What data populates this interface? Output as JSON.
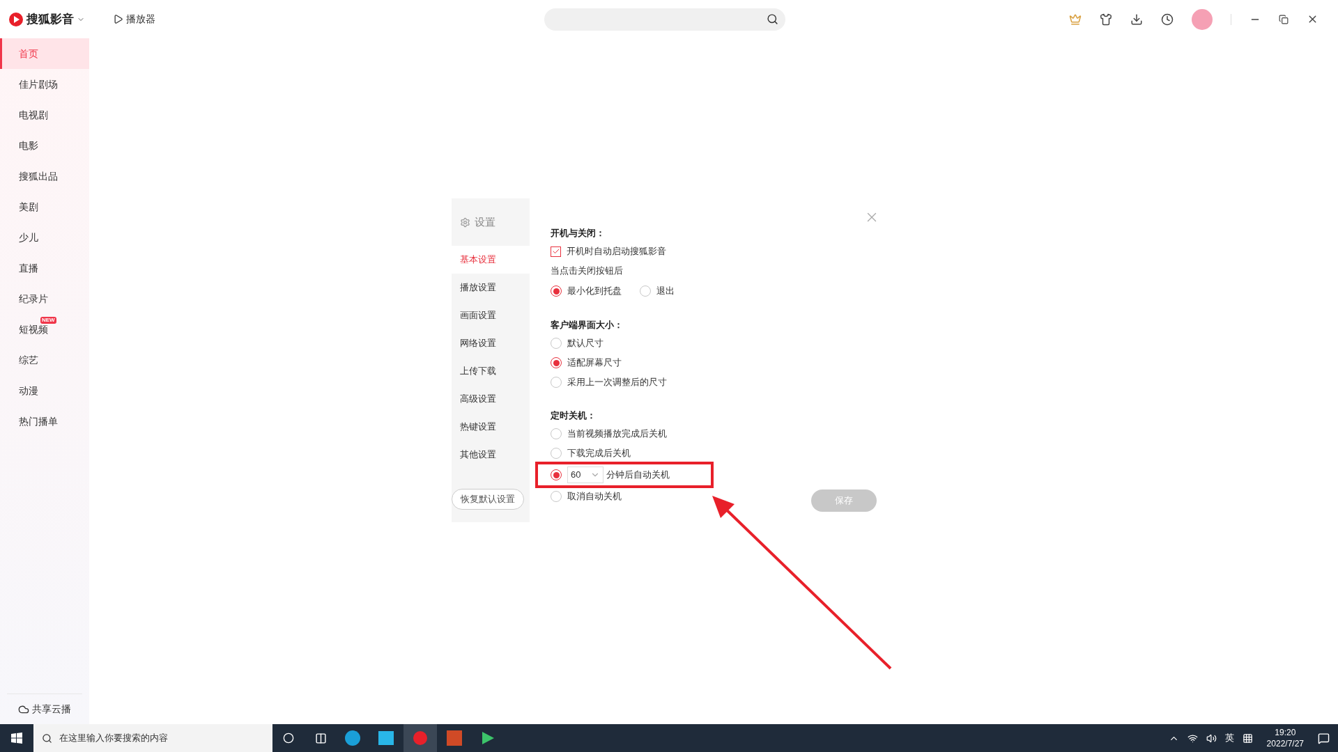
{
  "app": {
    "title": "搜狐影音",
    "player_button": "播放器"
  },
  "sidebar": {
    "items": [
      {
        "label": "首页",
        "selected": true
      },
      {
        "label": "佳片剧场",
        "selected": false
      },
      {
        "label": "电视剧",
        "selected": false
      },
      {
        "label": "电影",
        "selected": false
      },
      {
        "label": "搜狐出品",
        "selected": false
      },
      {
        "label": "美剧",
        "selected": false
      },
      {
        "label": "少儿",
        "selected": false
      },
      {
        "label": "直播",
        "selected": false
      },
      {
        "label": "纪录片",
        "selected": false
      },
      {
        "label": "短视频",
        "selected": false,
        "badge": "NEW"
      },
      {
        "label": "综艺",
        "selected": false
      },
      {
        "label": "动漫",
        "selected": false
      },
      {
        "label": "热门播单",
        "selected": false
      }
    ],
    "footer": "共享云播"
  },
  "settings": {
    "title": "设置",
    "nav": [
      {
        "label": "基本设置",
        "selected": true
      },
      {
        "label": "播放设置",
        "selected": false
      },
      {
        "label": "画面设置",
        "selected": false
      },
      {
        "label": "网络设置",
        "selected": false
      },
      {
        "label": "上传下载",
        "selected": false
      },
      {
        "label": "高级设置",
        "selected": false
      },
      {
        "label": "热键设置",
        "selected": false
      },
      {
        "label": "其他设置",
        "selected": false
      }
    ],
    "restore_button": "恢复默认设置",
    "save_button": {
      "label": "保存",
      "disabled": true
    },
    "sections": [
      {
        "heading": "开机与关闭：",
        "rows": [
          {
            "kind": "checkbox",
            "label": "开机时自动启动搜狐影音",
            "checked": true
          },
          {
            "kind": "note",
            "label": "当点击关闭按钮后"
          },
          {
            "kind": "inline",
            "options": [
              {
                "label": "最小化到托盘",
                "selected": true
              },
              {
                "label": "退出",
                "selected": false
              }
            ]
          }
        ]
      },
      {
        "heading": "客户端界面大小：",
        "rows": [
          {
            "kind": "radio",
            "label": "默认尺寸",
            "selected": false
          },
          {
            "kind": "radio",
            "label": "适配屏幕尺寸",
            "selected": true
          },
          {
            "kind": "radio",
            "label": "采用上一次调整后的尺寸",
            "selected": false
          }
        ]
      },
      {
        "heading": "定时关机：",
        "rows": [
          {
            "kind": "radio",
            "label": "当前视频播放完成后关机",
            "selected": false
          },
          {
            "kind": "radio",
            "label": "下载完成后关机",
            "selected": false
          },
          {
            "kind": "select",
            "value": "60",
            "label": "分钟后自动关机",
            "selected": true,
            "highlighted": true
          },
          {
            "kind": "radio",
            "label": "取消自动关机",
            "selected": false
          }
        ]
      }
    ]
  },
  "taskbar": {
    "search_placeholder": "在这里输入你要搜索的内容",
    "ime": "英",
    "time": "19:20",
    "date": "2022/7/27"
  }
}
